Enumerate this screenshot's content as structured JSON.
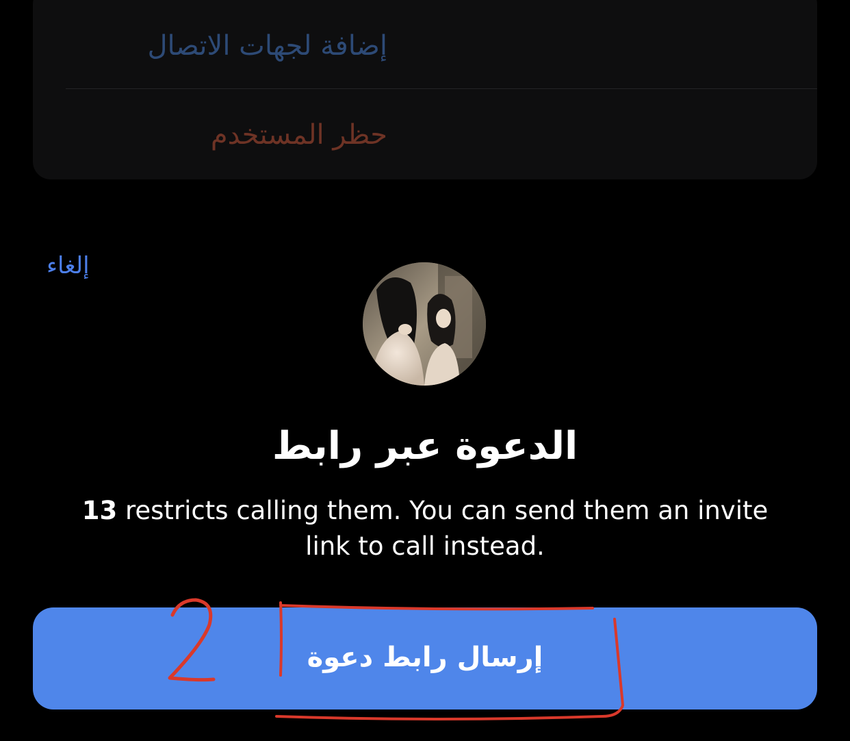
{
  "context_menu": {
    "add_contact_label": "إضافة لجهات الاتصال",
    "block_user_label": "حظر المستخدم"
  },
  "sheet": {
    "cancel_label": "إلغاء",
    "title": "الدعوة عبر رابط",
    "description_name": "13",
    "description_text": " restricts calling them. You can send them an invite link to call instead.",
    "button_label": "إرسال رابط دعوة"
  },
  "annotation": {
    "step_number": "2"
  },
  "colors": {
    "accent": "#4f86ea",
    "link": "#4c7fea",
    "annotation": "#d9392b"
  }
}
